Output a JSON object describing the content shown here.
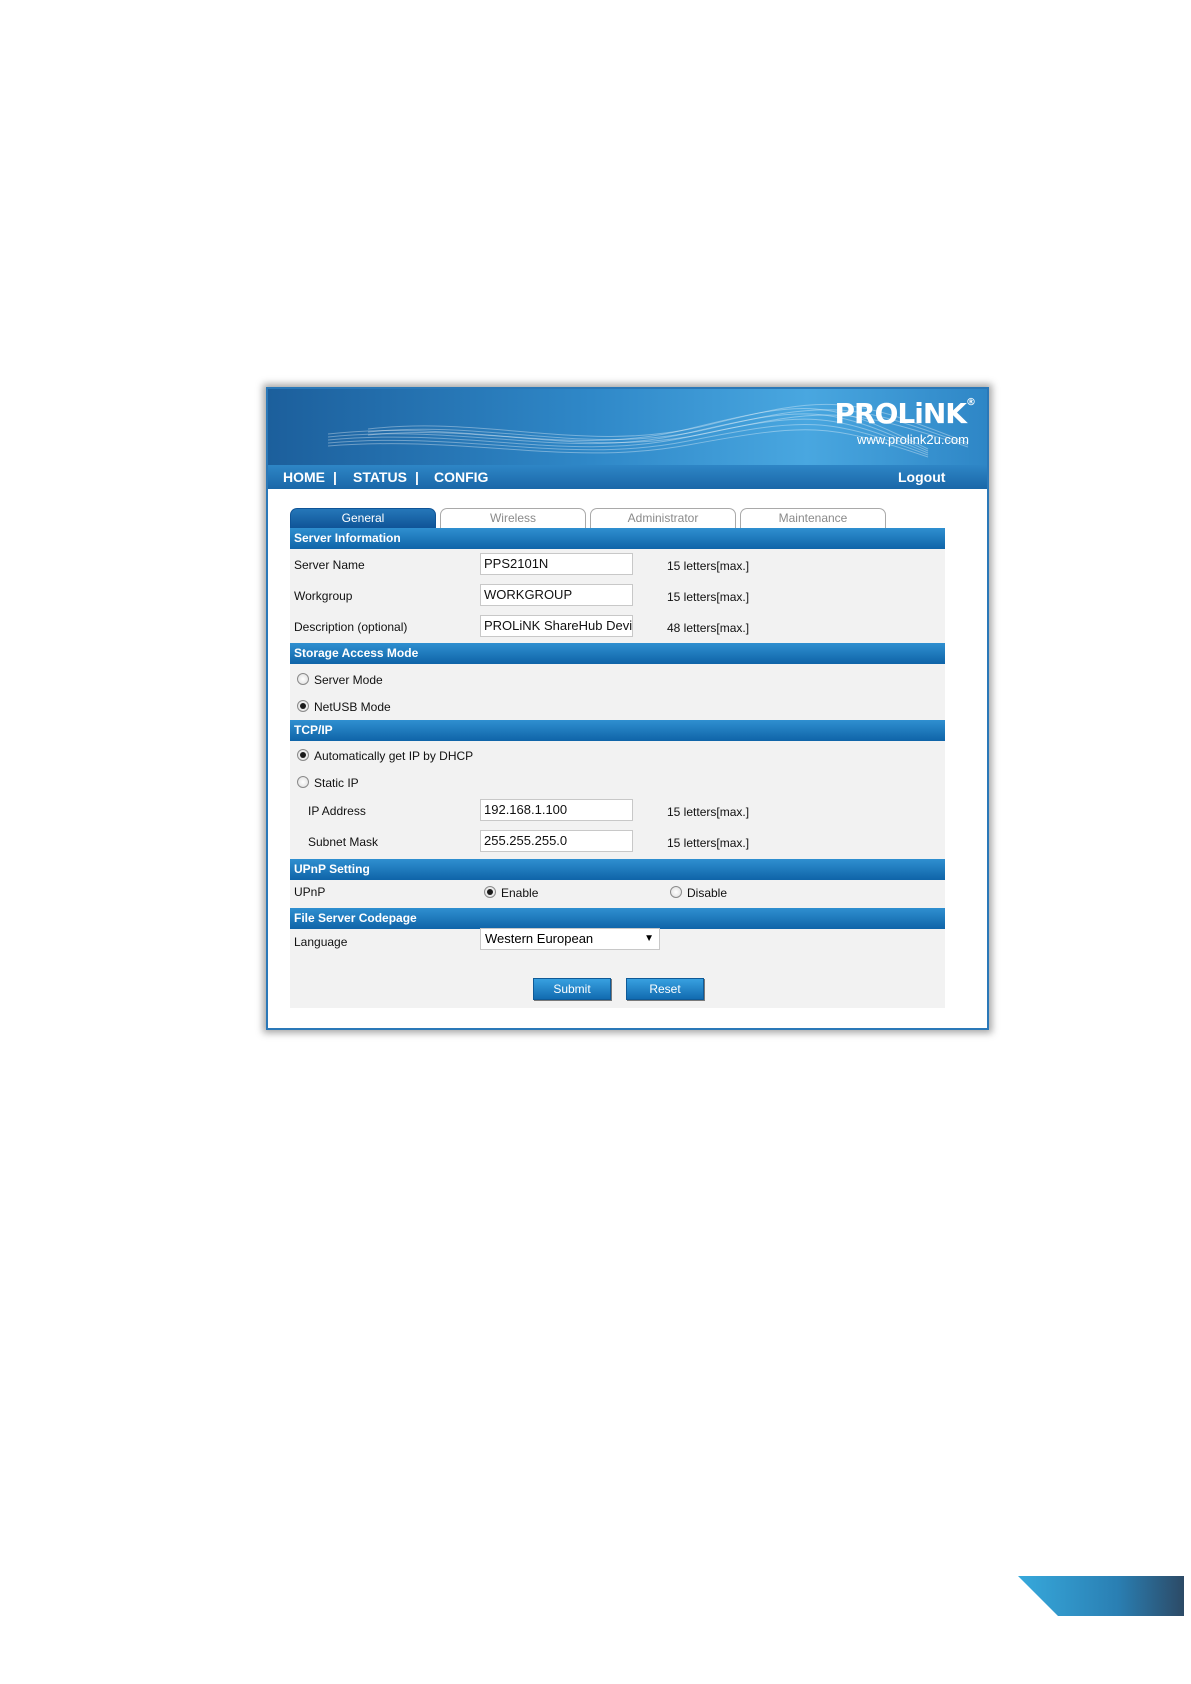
{
  "header": {
    "brand": "PROLiNK",
    "brand_mark": "®",
    "url": "www.prolink2u.com"
  },
  "nav": {
    "items": [
      "HOME",
      "STATUS",
      "CONFIG"
    ],
    "separator": "|",
    "logout": "Logout"
  },
  "tabs": [
    {
      "label": "General",
      "active": true
    },
    {
      "label": "Wireless",
      "active": false
    },
    {
      "label": "Administrator",
      "active": false
    },
    {
      "label": "Maintenance",
      "active": false
    }
  ],
  "server_info": {
    "title": "Server Information",
    "server_name": {
      "label": "Server Name",
      "value": "PPS2101N",
      "hint": "15 letters[max.]"
    },
    "workgroup": {
      "label": "Workgroup",
      "value": "WORKGROUP",
      "hint": "15 letters[max.]"
    },
    "description": {
      "label": "Description (optional)",
      "value": "PROLiNK ShareHub Devic",
      "hint": "48 letters[max.]"
    }
  },
  "storage_mode": {
    "title": "Storage Access Mode",
    "options": [
      {
        "label": "Server Mode",
        "checked": false
      },
      {
        "label": "NetUSB Mode",
        "checked": true
      }
    ]
  },
  "tcpip": {
    "title": "TCP/IP",
    "dhcp": {
      "label": "Automatically get IP by DHCP",
      "checked": true
    },
    "static": {
      "label": "Static IP",
      "checked": false
    },
    "ip_address": {
      "label": "IP Address",
      "value": "192.168.1.100",
      "hint": "15 letters[max.]"
    },
    "subnet_mask": {
      "label": "Subnet Mask",
      "value": "255.255.255.0",
      "hint": "15 letters[max.]"
    }
  },
  "upnp": {
    "title": "UPnP Setting",
    "label": "UPnP",
    "enable": {
      "label": "Enable",
      "checked": true
    },
    "disable": {
      "label": "Disable",
      "checked": false
    }
  },
  "codepage": {
    "title": "File Server Codepage",
    "label": "Language",
    "selected": "Western European"
  },
  "actions": {
    "submit": "Submit",
    "reset": "Reset"
  },
  "colors": {
    "header_blue": "#1c5f9c",
    "section_blue": "#0f64a8",
    "panel_bg": "#f2f2f2"
  }
}
